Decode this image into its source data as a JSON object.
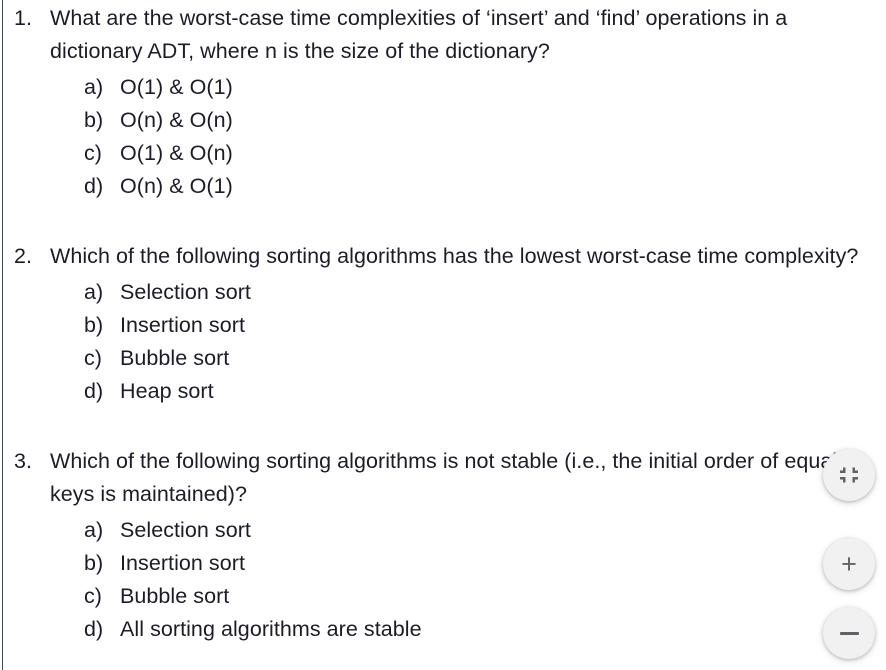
{
  "document": {
    "background_color": "#ffffff",
    "text_color": "#1c1c28",
    "questions": [
      {
        "number": "1.",
        "stem": "What are the worst-case time complexities of ‘insert’ and ‘find’ operations in a dictionary ADT, where n is the size of the dictionary?",
        "options": [
          {
            "marker": "a)",
            "text": "O(1) & O(1)"
          },
          {
            "marker": "b)",
            "text": "O(n) & O(n)"
          },
          {
            "marker": "c)",
            "text": "O(1) & O(n)"
          },
          {
            "marker": "d)",
            "text": "O(n) & O(1)"
          }
        ]
      },
      {
        "number": "2.",
        "stem": "Which of the following sorting algorithms has the lowest worst-case time complexity?",
        "options": [
          {
            "marker": "a)",
            "text": "Selection sort"
          },
          {
            "marker": "b)",
            "text": "Insertion sort"
          },
          {
            "marker": "c)",
            "text": "Bubble sort"
          },
          {
            "marker": "d)",
            "text": "Heap sort"
          }
        ]
      },
      {
        "number": "3.",
        "stem": "Which of the following sorting algorithms is not stable (i.e., the initial order of equal keys is maintained)?",
        "options": [
          {
            "marker": "a)",
            "text": "Selection sort"
          },
          {
            "marker": "b)",
            "text": "Insertion sort"
          },
          {
            "marker": "c)",
            "text": "Bubble sort"
          },
          {
            "marker": "d)",
            "text": "All sorting algorithms are stable"
          }
        ]
      }
    ]
  },
  "viewer_controls": {
    "fit_label": "",
    "zoom_in_label": "+",
    "zoom_out_label": "",
    "button_color": "#f1f1f1",
    "icon_color": "#5f6368"
  }
}
